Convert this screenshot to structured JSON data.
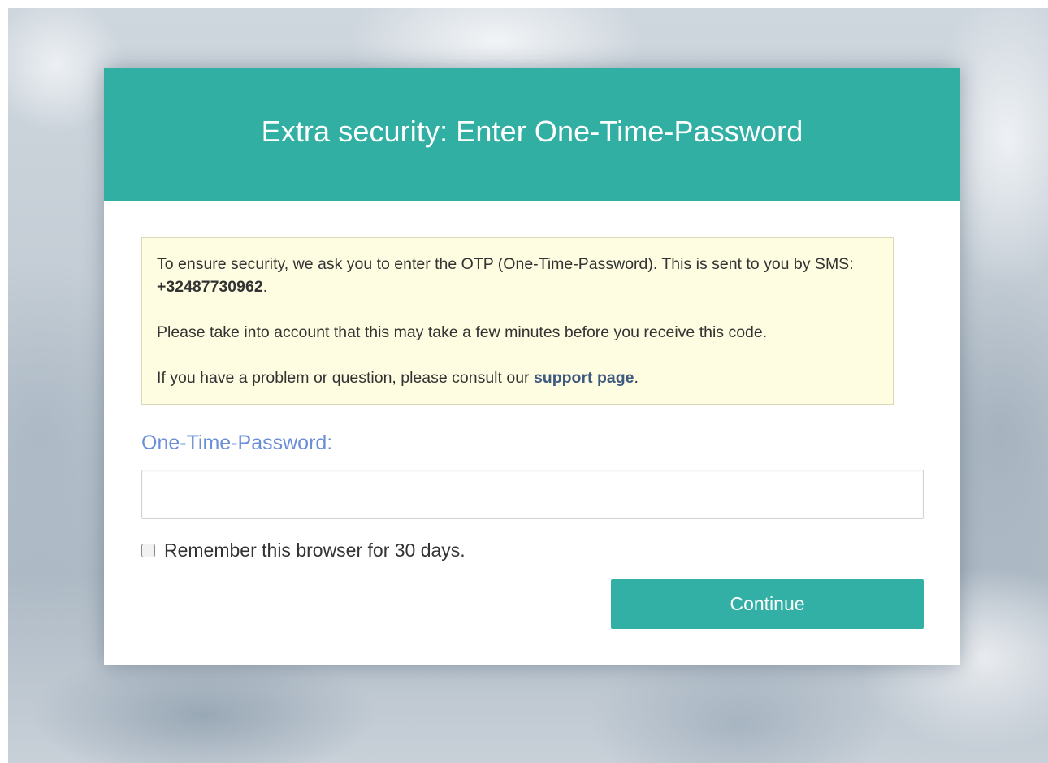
{
  "dialog": {
    "title": "Extra security: Enter One-Time-Password"
  },
  "notice": {
    "line1_prefix": "To ensure security, we ask you to enter the OTP (One-Time-Password). This is sent to you by SMS: ",
    "phone_number": "+32487730962",
    "line1_suffix": ".",
    "line2": "Please take into account that this may take a few minutes before you receive this code.",
    "line3_prefix": "If you have a problem or question, please consult our ",
    "support_link": "support page",
    "line3_suffix": "."
  },
  "form": {
    "otp_label": "One-Time-Password:",
    "otp_value": "",
    "remember_label": "Remember this browser for 30 days.",
    "remember_checked": false,
    "continue_label": "Continue"
  },
  "colors": {
    "header": "#31afa3",
    "button": "#33b0a5",
    "label": "#6a8fd8",
    "notice_bg": "#fefde1",
    "link": "#3f5a7f"
  }
}
